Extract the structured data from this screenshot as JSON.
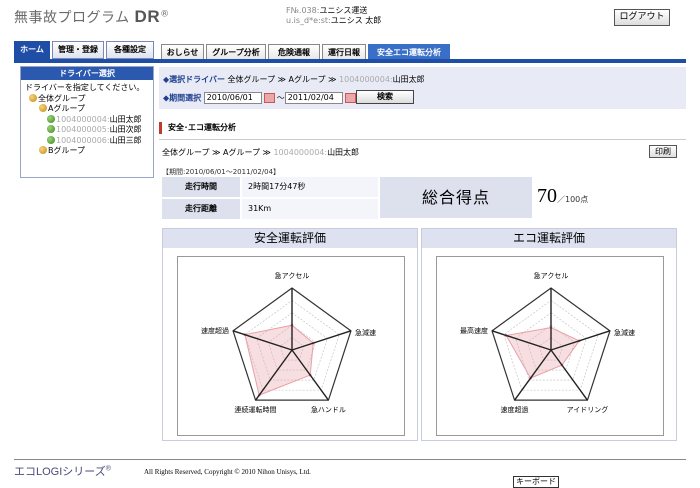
{
  "header": {
    "app_title": "無事故プログラム",
    "app_title_bold": "DR",
    "app_title_mark": "®",
    "user_line1_dim": "F№.038:",
    "user_line1": "ユニシス運送",
    "user_line2_dim": "u.is_d*e:st:",
    "user_line2": "ユニシス 太郎",
    "logout_label": "ログアウト"
  },
  "left_tabs": [
    {
      "label": "ホーム"
    },
    {
      "label": "管理・登録"
    },
    {
      "label": "各種設定"
    }
  ],
  "main_tabs": [
    {
      "label": "おしらせ"
    },
    {
      "label": "グループ分析"
    },
    {
      "label": "危険通報"
    },
    {
      "label": "運行日報"
    },
    {
      "label": "安全エコ運転分析"
    }
  ],
  "sidebar": {
    "title": "ドライバー選択",
    "instruction": "ドライバーを指定してください。",
    "root": "全体グループ",
    "group_a": "Aグループ",
    "drivers": [
      {
        "id": "1004000004:",
        "name": "山田太郎"
      },
      {
        "id": "1004000005:",
        "name": "山田次郎"
      },
      {
        "id": "1004000006:",
        "name": "山田三郎"
      }
    ],
    "group_b": "Bグループ"
  },
  "filter": {
    "driver_label": "◆選択ドライバー",
    "driver_path_1": "全体グループ",
    "driver_sep": "≫",
    "driver_path_2": "Aグループ",
    "driver_id": "1004000004:",
    "driver_name": "山田太郎",
    "period_label": "◆期間選択",
    "date_from": "2010/06/01",
    "date_tilde": "～",
    "date_to": "2011/02/04",
    "search_label": "検索"
  },
  "analysis": {
    "section_title": "安全･エコ運転分析",
    "bc_1": "全体グループ",
    "bc_sep": "≫",
    "bc_2": "Aグループ",
    "bc_id": "1004000004:",
    "bc_name": "山田太郎",
    "print_label": "印刷",
    "period_text": "【期間:2010/06/01～2011/02/04】",
    "drive_time_label": "走行時間",
    "drive_time_value": "2時間17分47秒",
    "distance_label": "走行距離",
    "distance_value": "31Km",
    "score_label": "総合得点",
    "score_value": "70",
    "score_unit": "／100点"
  },
  "chart_data": [
    {
      "type": "radar",
      "title": "安全運転評価",
      "axes": [
        "急アクセル",
        "急減速",
        "急ハンドル",
        "連続運転時間",
        "速度超過"
      ],
      "rmax": 5,
      "rings": 5,
      "series": [
        {
          "values": [
            2.0,
            1.8,
            2.5,
            4.5,
            4.0
          ],
          "color": "#e8a0a8"
        }
      ]
    },
    {
      "type": "radar",
      "title": "エコ運転評価",
      "axes": [
        "急アクセル",
        "急減速",
        "アイドリング",
        "速度超過",
        "最高速度"
      ],
      "rmax": 5,
      "rings": 5,
      "series": [
        {
          "values": [
            1.8,
            2.4,
            1.5,
            2.8,
            3.8
          ],
          "color": "#e8a0a8"
        }
      ]
    }
  ],
  "footer": {
    "brand": "エコLOGIシリーズ",
    "brand_mark": "®",
    "copyright": "All Rights Reserved, Copyright © 2010 Nihon Unisys, Ltd.",
    "keyboard_label": "キーボード"
  }
}
